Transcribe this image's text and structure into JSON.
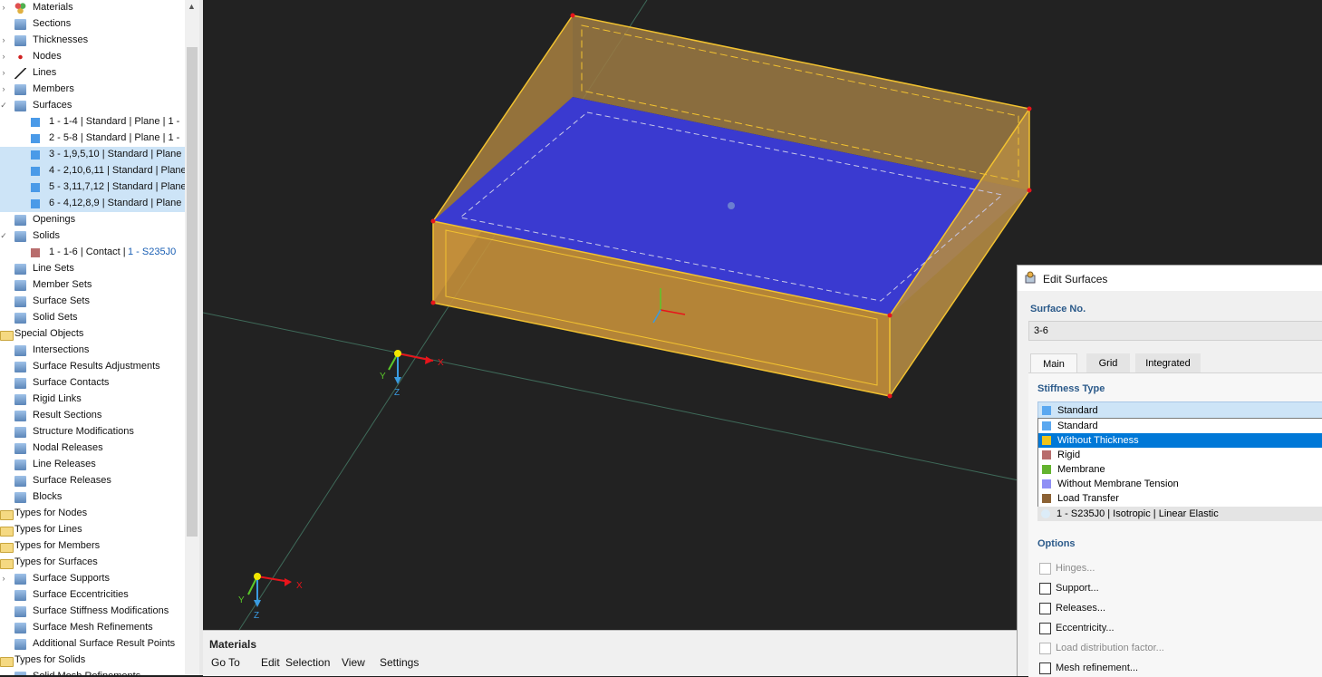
{
  "navigator": {
    "items": [
      {
        "label": "Materials",
        "icon": "materials-icon",
        "indent": 1,
        "exp": ">"
      },
      {
        "label": "Sections",
        "icon": "section-icon",
        "indent": 1,
        "exp": ""
      },
      {
        "label": "Thicknesses",
        "icon": "thickness-icon",
        "indent": 1,
        "exp": ">"
      },
      {
        "label": "Nodes",
        "icon": "node-icon",
        "indent": 1,
        "exp": ">"
      },
      {
        "label": "Lines",
        "icon": "line-icon",
        "indent": 1,
        "exp": ">"
      },
      {
        "label": "Members",
        "icon": "member-icon",
        "indent": 1,
        "exp": ">"
      },
      {
        "label": "Surfaces",
        "icon": "surface-icon",
        "indent": 1,
        "exp": "v"
      },
      {
        "label": "1 - 1-4 | Standard | Plane | 1 -",
        "icon": "surface-item-icon",
        "indent": 2,
        "exp": "",
        "sel": false
      },
      {
        "label": "2 - 5-8 | Standard | Plane | 1 -",
        "icon": "surface-item-icon",
        "indent": 2,
        "exp": "",
        "sel": false
      },
      {
        "label": "3 - 1,9,5,10 | Standard | Plane",
        "icon": "surface-item-icon",
        "indent": 2,
        "exp": "",
        "sel": true
      },
      {
        "label": "4 - 2,10,6,11 | Standard | Plane",
        "icon": "surface-item-icon",
        "indent": 2,
        "exp": "",
        "sel": true
      },
      {
        "label": "5 - 3,11,7,12 | Standard | Plane",
        "icon": "surface-item-icon",
        "indent": 2,
        "exp": "",
        "sel": true
      },
      {
        "label": "6 - 4,12,8,9 | Standard | Plane",
        "icon": "surface-item-icon",
        "indent": 2,
        "exp": "",
        "sel": true
      },
      {
        "label": "Openings",
        "icon": "opening-icon",
        "indent": 1,
        "exp": ""
      },
      {
        "label": "Solids",
        "icon": "solid-icon",
        "indent": 1,
        "exp": "v"
      },
      {
        "label": "1 - 1-6 | Contact | ",
        "tag": "1 - S235J0",
        "icon": "solid-item-icon",
        "indent": 2,
        "exp": "",
        "sel": false
      },
      {
        "label": "Line Sets",
        "icon": "line-set-icon",
        "indent": 1,
        "exp": ""
      },
      {
        "label": "Member Sets",
        "icon": "member-set-icon",
        "indent": 1,
        "exp": ""
      },
      {
        "label": "Surface Sets",
        "icon": "surface-set-icon",
        "indent": 1,
        "exp": ""
      },
      {
        "label": "Solid Sets",
        "icon": "solid-set-icon",
        "indent": 1,
        "exp": ""
      },
      {
        "label": "Special Objects",
        "icon": "folder-icon",
        "indent": 0,
        "exp": ""
      },
      {
        "label": "Intersections",
        "icon": "intersection-icon",
        "indent": 1,
        "exp": ""
      },
      {
        "label": "Surface Results Adjustments",
        "icon": "results-adjust-icon",
        "indent": 1,
        "exp": ""
      },
      {
        "label": "Surface Contacts",
        "icon": "surface-contact-icon",
        "indent": 1,
        "exp": ""
      },
      {
        "label": "Rigid Links",
        "icon": "rigid-link-icon",
        "indent": 1,
        "exp": ""
      },
      {
        "label": "Result Sections",
        "icon": "result-section-icon",
        "indent": 1,
        "exp": ""
      },
      {
        "label": "Structure Modifications",
        "icon": "structure-mod-icon",
        "indent": 1,
        "exp": ""
      },
      {
        "label": "Nodal Releases",
        "icon": "nodal-release-icon",
        "indent": 1,
        "exp": ""
      },
      {
        "label": "Line Releases",
        "icon": "line-release-icon",
        "indent": 1,
        "exp": ""
      },
      {
        "label": "Surface Releases",
        "icon": "surface-release-icon",
        "indent": 1,
        "exp": ""
      },
      {
        "label": "Blocks",
        "icon": "block-icon",
        "indent": 1,
        "exp": ""
      },
      {
        "label": "Types for Nodes",
        "icon": "folder-icon",
        "indent": 0,
        "exp": ""
      },
      {
        "label": "Types for Lines",
        "icon": "folder-icon",
        "indent": 0,
        "exp": ""
      },
      {
        "label": "Types for Members",
        "icon": "folder-icon",
        "indent": 0,
        "exp": ""
      },
      {
        "label": "Types for Surfaces",
        "icon": "folder-icon",
        "indent": 0,
        "exp": ""
      },
      {
        "label": "Surface Supports",
        "icon": "surface-support-icon",
        "indent": 1,
        "exp": ">"
      },
      {
        "label": "Surface Eccentricities",
        "icon": "surface-ecc-icon",
        "indent": 1,
        "exp": ""
      },
      {
        "label": "Surface Stiffness Modifications",
        "icon": "stiffness-mod-icon",
        "indent": 1,
        "exp": ""
      },
      {
        "label": "Surface Mesh Refinements",
        "icon": "mesh-refine-icon",
        "indent": 1,
        "exp": ""
      },
      {
        "label": "Additional Surface Result Points",
        "icon": "result-point-icon",
        "indent": 1,
        "exp": ""
      },
      {
        "label": "Types for Solids",
        "icon": "folder-icon",
        "indent": 0,
        "exp": ""
      },
      {
        "label": "Solid Mesh Refinements",
        "icon": "solid-mesh-icon",
        "indent": 1,
        "exp": ""
      }
    ]
  },
  "viewport": {
    "axis_main": {
      "x": "X",
      "y": "Y",
      "z": "Z"
    },
    "axis_corner": {
      "x": "X",
      "y": "Y",
      "z": "Z"
    }
  },
  "materials_pane": {
    "title": "Materials",
    "menu": [
      "Go To",
      "Edit",
      "Selection",
      "View",
      "Settings"
    ]
  },
  "dialog": {
    "title": "Edit Surfaces",
    "surface_no_label": "Surface No.",
    "surface_no_value": "3-6",
    "tabs": [
      "Main",
      "Grid",
      "Integrated"
    ],
    "stiffness_label": "Stiffness Type",
    "selected_value": "Standard",
    "options": [
      {
        "label": "Standard",
        "color": "#5ba8f0"
      },
      {
        "label": "Without Thickness",
        "color": "#f0c419"
      },
      {
        "label": "Rigid",
        "color": "#b86d6d"
      },
      {
        "label": "Membrane",
        "color": "#63b32e"
      },
      {
        "label": "Without Membrane Tension",
        "color": "#8f8ff5"
      },
      {
        "label": "Load Transfer",
        "color": "#8c6234"
      }
    ],
    "highlighted_index": 1,
    "material_value": "1 - S235J0 | Isotropic | Linear Elastic",
    "options_label": "Options",
    "checkboxes": [
      {
        "label": "Hinges...",
        "disabled": true
      },
      {
        "label": "Support...",
        "disabled": false
      },
      {
        "label": "Releases...",
        "disabled": false
      },
      {
        "label": "Eccentricity...",
        "disabled": false
      },
      {
        "label": "Load distribution factor...",
        "disabled": true
      },
      {
        "label": "Mesh refinement...",
        "disabled": false
      }
    ]
  },
  "colors": {
    "box_face": "#c8923a",
    "box_edge": "#f2c230",
    "floor": "#3a3ad0",
    "arrow": "#e8141b"
  }
}
